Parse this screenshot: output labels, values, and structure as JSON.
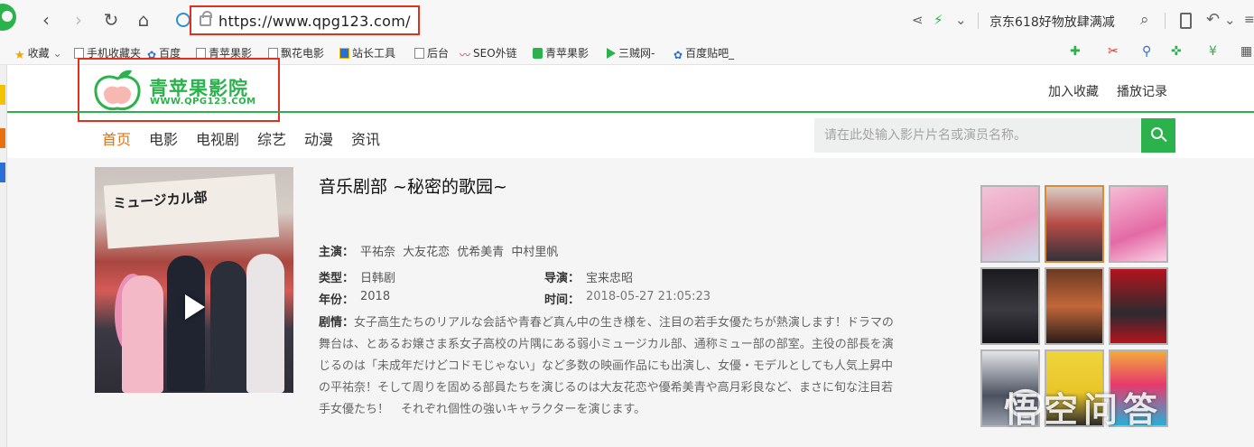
{
  "browser": {
    "url": "https://www.qpg123.com/",
    "promo": "京东618好物放肆满减",
    "back": "‹",
    "forward": "›",
    "refresh": "↻",
    "home": "⌂",
    "share": "⋖",
    "bolt": "⚡",
    "chevron": "⌄",
    "search_glyph": "⌕"
  },
  "bookmarks": [
    {
      "label": "收藏",
      "icon": "star-icon"
    },
    {
      "label": "手机收藏夹",
      "icon": "page-icon"
    },
    {
      "label": "百度",
      "icon": "paw-icon"
    },
    {
      "label": "青苹果影",
      "icon": "page-icon"
    },
    {
      "label": "飘花电影",
      "icon": "page-icon"
    },
    {
      "label": "站长工具",
      "icon": "tools-icon"
    },
    {
      "label": "后台",
      "icon": "page-icon"
    },
    {
      "label": "SEO外链",
      "icon": "seo-icon"
    },
    {
      "label": "青苹果影",
      "icon": "green-icon"
    },
    {
      "label": "三贼网-",
      "icon": "play-icon"
    },
    {
      "label": "百度贴吧_",
      "icon": "paw-icon"
    }
  ],
  "site": {
    "logo_name": "青苹果影院",
    "logo_url": "WWW.QPG123.COM",
    "header_links": [
      "加入收藏",
      "播放记录"
    ],
    "nav": [
      "首页",
      "电影",
      "电视剧",
      "综艺",
      "动漫",
      "资讯"
    ],
    "search_placeholder": "请在此处输入影片片名或演员名称。"
  },
  "movie": {
    "title": "音乐剧部 ~秘密的歌园~",
    "poster_text": "ミュージカル部",
    "cast_label": "主演：",
    "cast": "平祐奈  大友花恋  优希美青  中村里帆",
    "type_label": "类型：",
    "type": "日韩剧",
    "director_label": "导演：",
    "director": "宝来忠昭",
    "year_label": "年份：",
    "year": "2018",
    "time_label": "时间：",
    "time": "2018-05-27 21:05:23",
    "plot_label": "剧情：",
    "plot": "女子高生たちのリアルな会話や青春ど真ん中の生き様を、注目の若手女優たちが熱演します！ドラマの舞台は、とあるお嬢さま系女子高校の片隅にある弱小ミュージカル部、通称ミュー部の部室。主役の部長を演じるのは「未成年だけどコドモじゃない」など多数の映画作品にも出演し、女優・モデルとしても人気上昇中の平祐奈！そして周りを固める部員たちを演じるのは大友花恋や優希美青や高月彩良など、まさに旬な注目若手女優たち！　それぞれ個性の強いキャラクターを演じます。"
  },
  "watermark": "悟空问答",
  "colors": {
    "brand_green": "#2bb24c",
    "nav_active": "#e8700e",
    "highlight_red": "#e0301e"
  }
}
